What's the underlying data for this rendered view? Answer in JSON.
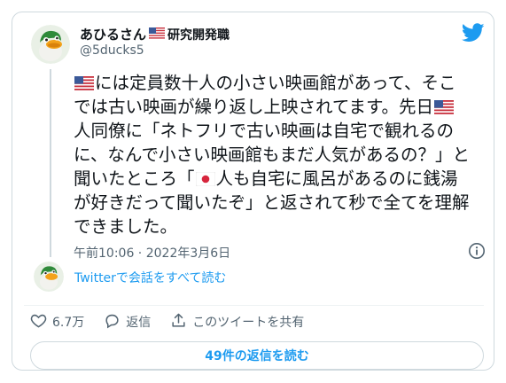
{
  "user": {
    "display_name": "あひるさん",
    "flag_after_name": "us-flag-icon",
    "title": "研究開発職",
    "handle": "@5ducks5"
  },
  "tweet": {
    "lines": [
      [
        {
          "flag": "us"
        },
        {
          "text": "には定員数十人の小さい映画館があって、そこ"
        }
      ],
      [
        {
          "text": "では古い映画が繰り返し上映されてます。先日"
        },
        {
          "flag": "us"
        }
      ],
      [
        {
          "text": "人同僚に「ネトフリで古い映画は自宅で観れるの"
        }
      ],
      [
        {
          "text": "に、なんで小さい映画館もまだ人気があるの？」と"
        }
      ],
      [
        {
          "text": "聞いたところ「"
        },
        {
          "flag": "jp"
        },
        {
          "text": "人も自宅に風呂があるのに銭湯"
        }
      ],
      [
        {
          "text": "が好きだって聞いたぞ」と返されて秒で全てを理解"
        }
      ],
      [
        {
          "text": "できました。"
        }
      ]
    ]
  },
  "meta": {
    "time": "午前10:06",
    "separator": " · ",
    "date": "2022年3月6日"
  },
  "thread_link": "Twitterで会話をすべて読む",
  "actions": {
    "like_count": "6.7万",
    "reply_label": "返信",
    "share_label": "このツイートを共有"
  },
  "read_replies_button": "49件の返信を読む",
  "colors": {
    "accent": "#1d9bf0",
    "text": "#0f1419",
    "secondary": "#536471",
    "border": "#cfd9de"
  }
}
